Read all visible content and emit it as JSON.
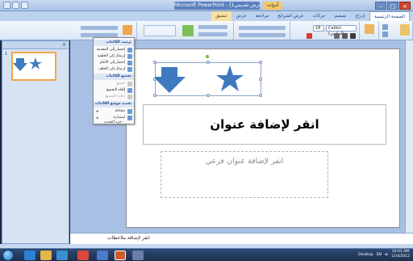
{
  "window": {
    "title": "Microsoft PowerPoint - [عرض تقديمي1]",
    "context_tab": "أدوات الرسم",
    "buttons": {
      "minimize": "–",
      "maximize": "□",
      "close": "×"
    }
  },
  "ribbon": {
    "tabs": [
      {
        "label": "الصفحة الرئيسية",
        "active": true
      },
      {
        "label": "إدراج"
      },
      {
        "label": "تصميم"
      },
      {
        "label": "حركات"
      },
      {
        "label": "عرض الشرائح"
      },
      {
        "label": "مراجعة"
      },
      {
        "label": "عرض"
      },
      {
        "label": "تنسيق",
        "format": true
      }
    ],
    "font_name": "Calibri (أساسي)",
    "font_size": "18"
  },
  "menu": {
    "sections": [
      {
        "header": "ترتيب الكائنات",
        "items": [
          "إحضار إلى المقدمة",
          "إرسال إلى الخلفية",
          "إحضار إلى الأمام",
          "إرسال إلى الخلف"
        ]
      },
      {
        "header": "تجميع الكائنات",
        "items": [
          "تجميع",
          "إلغاء التجميع",
          "إعادة التجميع"
        ]
      },
      {
        "header": "تحديد موضع الكائنات",
        "items": [
          "محاذاة",
          "استدارة",
          "جزء التحديد..."
        ]
      }
    ]
  },
  "slide": {
    "title_placeholder": "انقر لإضافة عنوان",
    "subtitle_placeholder": "انقر لإضافة عنوان فرعي",
    "thumbnail_number": "1"
  },
  "notes": {
    "placeholder": "انقر لإضافة ملاحظات"
  },
  "taskbar": {
    "language": "EN",
    "desktop": "Desktop",
    "time": "10:01 AM",
    "date": "12/4/2012"
  },
  "colors": {
    "shape_fill": "#3f79bf",
    "selection_border": "#8aa6c6",
    "format_tab": "#f6e0a3",
    "taskbar": "#1c2f4f"
  }
}
